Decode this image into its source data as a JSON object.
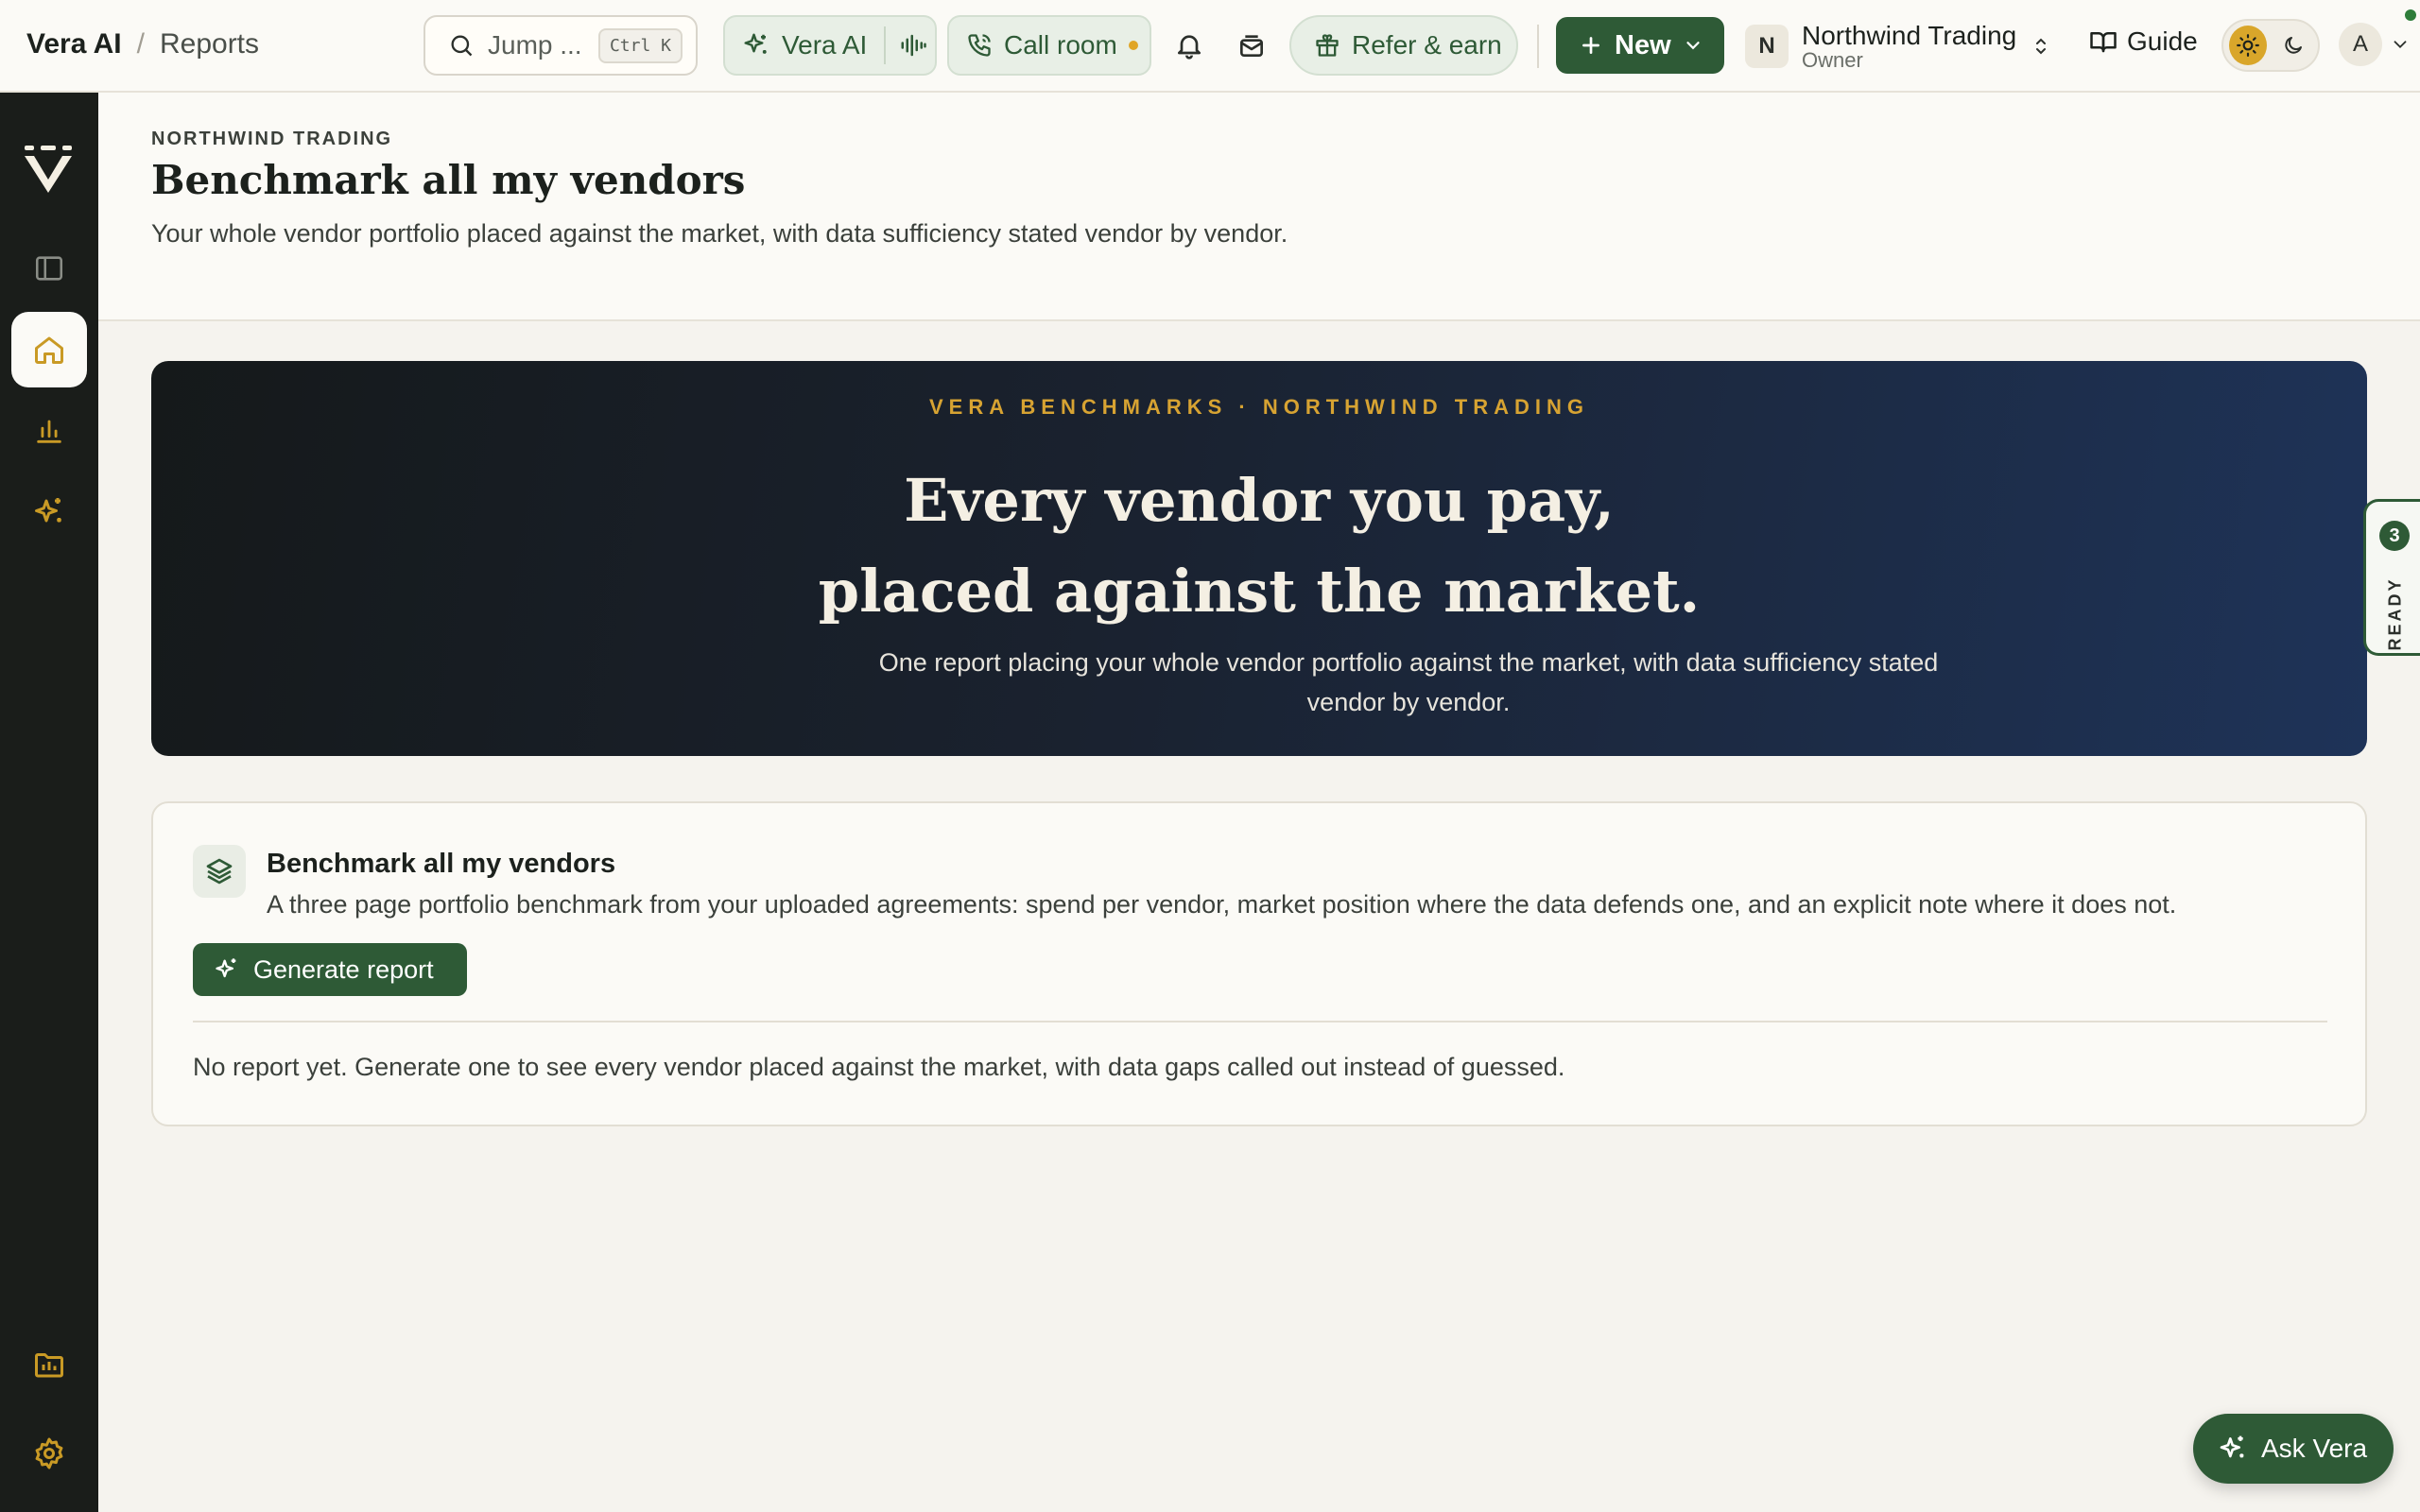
{
  "topbar": {
    "breadcrumb": {
      "app": "Vera AI",
      "separator": "/",
      "page": "Reports"
    },
    "search": {
      "placeholder": "Jump ...",
      "shortcut": "Ctrl K"
    },
    "vera_ai": {
      "label": "Vera AI"
    },
    "call_room": {
      "label": "Call room",
      "status_color": "#e0a526"
    },
    "refer": {
      "label": "Refer & earn"
    },
    "new_button": {
      "label": "New"
    },
    "org": {
      "initial": "N",
      "name": "Northwind Trading",
      "role": "Owner"
    },
    "guide": {
      "label": "Guide"
    },
    "theme": {
      "active": "light"
    },
    "user": {
      "initial": "A"
    }
  },
  "sidebar": {
    "items": [
      {
        "name": "toggle-sidebar",
        "icon": "sidebar-panel-icon",
        "active": false
      },
      {
        "name": "home",
        "icon": "home-icon",
        "active": true
      },
      {
        "name": "analytics",
        "icon": "bar-chart-icon",
        "active": false
      },
      {
        "name": "vera-ai",
        "icon": "sparkles-icon",
        "active": false
      },
      {
        "name": "reports-folder",
        "icon": "folder-chart-icon",
        "active": false
      },
      {
        "name": "settings",
        "icon": "gear-icon",
        "active": false
      }
    ]
  },
  "header": {
    "eyebrow": "NORTHWIND TRADING",
    "title": "Benchmark all my vendors",
    "description": "Your whole vendor portfolio placed against the market, with data sufficiency stated vendor by vendor."
  },
  "hero": {
    "eyebrow": "VERA BENCHMARKS · NORTHWIND TRADING",
    "title_line1": "Every vendor you pay,",
    "title_line2": "placed against the market.",
    "subtitle": "One report placing your whole vendor portfolio against the market, with data sufficiency stated vendor by vendor."
  },
  "ready_tab": {
    "count": "3",
    "label": "READY"
  },
  "report_card": {
    "title": "Benchmark all my vendors",
    "description": "A three page portfolio benchmark from your uploaded agreements: spend per vendor, market position where the data defends one, and an explicit note where it does not.",
    "button_label": "Generate report",
    "empty_state": "No report yet. Generate one to see every vendor placed against the market, with data gaps called out instead of guessed."
  },
  "ask_vera": {
    "label": "Ask Vera"
  },
  "colors": {
    "brand_green": "#2e5a36",
    "accent_gold": "#d7a332",
    "sidebar_bg": "#1a1d1a",
    "hero_gradient_end": "#1e3358"
  }
}
